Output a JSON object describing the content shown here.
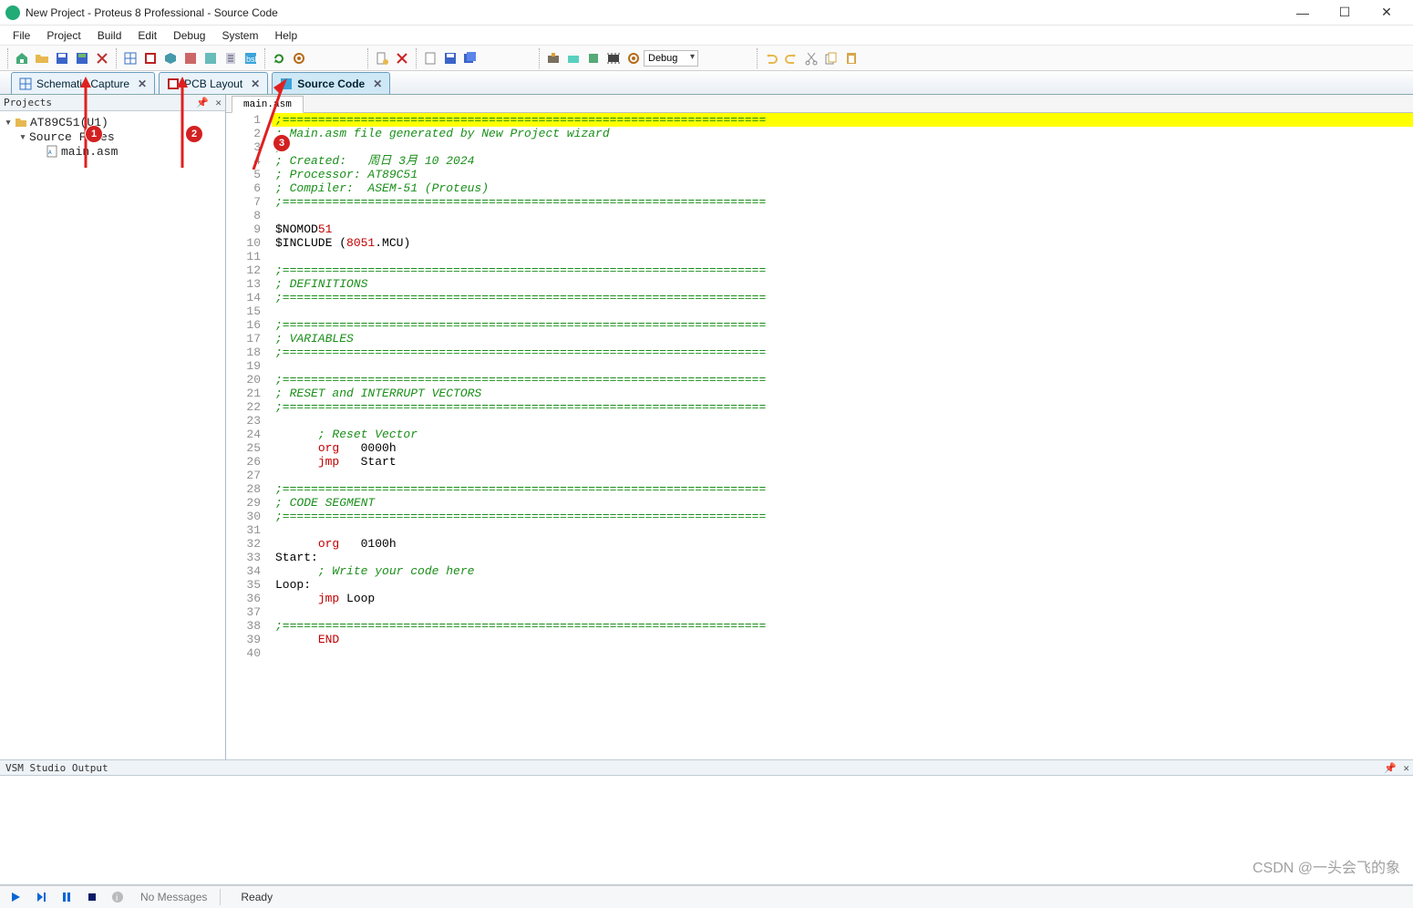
{
  "window": {
    "title": "New Project - Proteus 8 Professional - Source Code"
  },
  "menu": {
    "items": [
      "File",
      "Project",
      "Build",
      "Edit",
      "Debug",
      "System",
      "Help"
    ]
  },
  "toolbar": {
    "config_selected": "Debug"
  },
  "tabs": {
    "schematic": "Schematic Capture",
    "pcb": "PCB Layout",
    "source": "Source Code"
  },
  "sidebar": {
    "title": "Projects",
    "root": "AT89C51(U1)",
    "folder": "Source Files",
    "file": "main.asm"
  },
  "editor": {
    "file_tab": "main.asm",
    "lines": [
      {
        "n": 1,
        "hl": true,
        "spans": [
          {
            "t": ";====================================================================",
            "c": "c-cmt"
          }
        ]
      },
      {
        "n": 2,
        "spans": [
          {
            "t": "; Main.asm file generated by New Project wizard",
            "c": "c-cmt"
          }
        ]
      },
      {
        "n": 3,
        "spans": [
          {
            "t": ";",
            "c": "c-cmt"
          }
        ]
      },
      {
        "n": 4,
        "spans": [
          {
            "t": "; Created:   周日 3月 10 2024",
            "c": "c-cmt"
          }
        ]
      },
      {
        "n": 5,
        "spans": [
          {
            "t": "; Processor: AT89C51",
            "c": "c-cmt"
          }
        ]
      },
      {
        "n": 6,
        "spans": [
          {
            "t": "; Compiler:  ASEM-51 (Proteus)",
            "c": "c-cmt"
          }
        ]
      },
      {
        "n": 7,
        "spans": [
          {
            "t": ";====================================================================",
            "c": "c-cmt"
          }
        ]
      },
      {
        "n": 8,
        "spans": []
      },
      {
        "n": 9,
        "spans": [
          {
            "t": "$NOMOD",
            "c": "c-dir"
          },
          {
            "t": "51",
            "c": "c-num"
          }
        ]
      },
      {
        "n": 10,
        "spans": [
          {
            "t": "$INCLUDE (",
            "c": "c-dir"
          },
          {
            "t": "8051",
            "c": "c-num"
          },
          {
            "t": ".MCU)",
            "c": "c-dir"
          }
        ]
      },
      {
        "n": 11,
        "spans": []
      },
      {
        "n": 12,
        "spans": [
          {
            "t": ";====================================================================",
            "c": "c-cmt"
          }
        ]
      },
      {
        "n": 13,
        "spans": [
          {
            "t": "; DEFINITIONS",
            "c": "c-cmt"
          }
        ]
      },
      {
        "n": 14,
        "spans": [
          {
            "t": ";====================================================================",
            "c": "c-cmt"
          }
        ]
      },
      {
        "n": 15,
        "spans": []
      },
      {
        "n": 16,
        "spans": [
          {
            "t": ";====================================================================",
            "c": "c-cmt"
          }
        ]
      },
      {
        "n": 17,
        "spans": [
          {
            "t": "; VARIABLES",
            "c": "c-cmt"
          }
        ]
      },
      {
        "n": 18,
        "spans": [
          {
            "t": ";====================================================================",
            "c": "c-cmt"
          }
        ]
      },
      {
        "n": 19,
        "spans": []
      },
      {
        "n": 20,
        "spans": [
          {
            "t": ";====================================================================",
            "c": "c-cmt"
          }
        ]
      },
      {
        "n": 21,
        "spans": [
          {
            "t": "; RESET and INTERRUPT VECTORS",
            "c": "c-cmt"
          }
        ]
      },
      {
        "n": 22,
        "spans": [
          {
            "t": ";====================================================================",
            "c": "c-cmt"
          }
        ]
      },
      {
        "n": 23,
        "spans": []
      },
      {
        "n": 24,
        "spans": [
          {
            "t": "      ; Reset Vector",
            "c": "c-cmt"
          }
        ]
      },
      {
        "n": 25,
        "spans": [
          {
            "t": "      ",
            "c": "c-plain"
          },
          {
            "t": "org",
            "c": "c-kw"
          },
          {
            "t": "   0000h",
            "c": "c-plain"
          }
        ]
      },
      {
        "n": 26,
        "spans": [
          {
            "t": "      ",
            "c": "c-plain"
          },
          {
            "t": "jmp",
            "c": "c-kw"
          },
          {
            "t": "   Start",
            "c": "c-plain"
          }
        ]
      },
      {
        "n": 27,
        "spans": []
      },
      {
        "n": 28,
        "spans": [
          {
            "t": ";====================================================================",
            "c": "c-cmt"
          }
        ]
      },
      {
        "n": 29,
        "spans": [
          {
            "t": "; CODE SEGMENT",
            "c": "c-cmt"
          }
        ]
      },
      {
        "n": 30,
        "spans": [
          {
            "t": ";====================================================================",
            "c": "c-cmt"
          }
        ]
      },
      {
        "n": 31,
        "spans": []
      },
      {
        "n": 32,
        "spans": [
          {
            "t": "      ",
            "c": "c-plain"
          },
          {
            "t": "org",
            "c": "c-kw"
          },
          {
            "t": "   0100h",
            "c": "c-plain"
          }
        ]
      },
      {
        "n": 33,
        "spans": [
          {
            "t": "Start:",
            "c": "c-plain"
          }
        ]
      },
      {
        "n": 34,
        "spans": [
          {
            "t": "      ; Write your code here",
            "c": "c-cmt"
          }
        ]
      },
      {
        "n": 35,
        "spans": [
          {
            "t": "Loop:",
            "c": "c-plain"
          }
        ]
      },
      {
        "n": 36,
        "spans": [
          {
            "t": "      ",
            "c": "c-plain"
          },
          {
            "t": "jmp",
            "c": "c-kw"
          },
          {
            "t": " Loop",
            "c": "c-plain"
          }
        ]
      },
      {
        "n": 37,
        "spans": []
      },
      {
        "n": 38,
        "spans": [
          {
            "t": ";====================================================================",
            "c": "c-cmt"
          }
        ]
      },
      {
        "n": 39,
        "spans": [
          {
            "t": "      ",
            "c": "c-plain"
          },
          {
            "t": "END",
            "c": "c-kw"
          }
        ]
      },
      {
        "n": 40,
        "spans": []
      }
    ]
  },
  "output": {
    "title": "VSM Studio Output"
  },
  "status": {
    "no_messages": "No Messages",
    "ready": "Ready"
  },
  "watermark": "CSDN @一头会飞的象",
  "callouts": {
    "c1": "1",
    "c2": "2",
    "c3": "3"
  }
}
